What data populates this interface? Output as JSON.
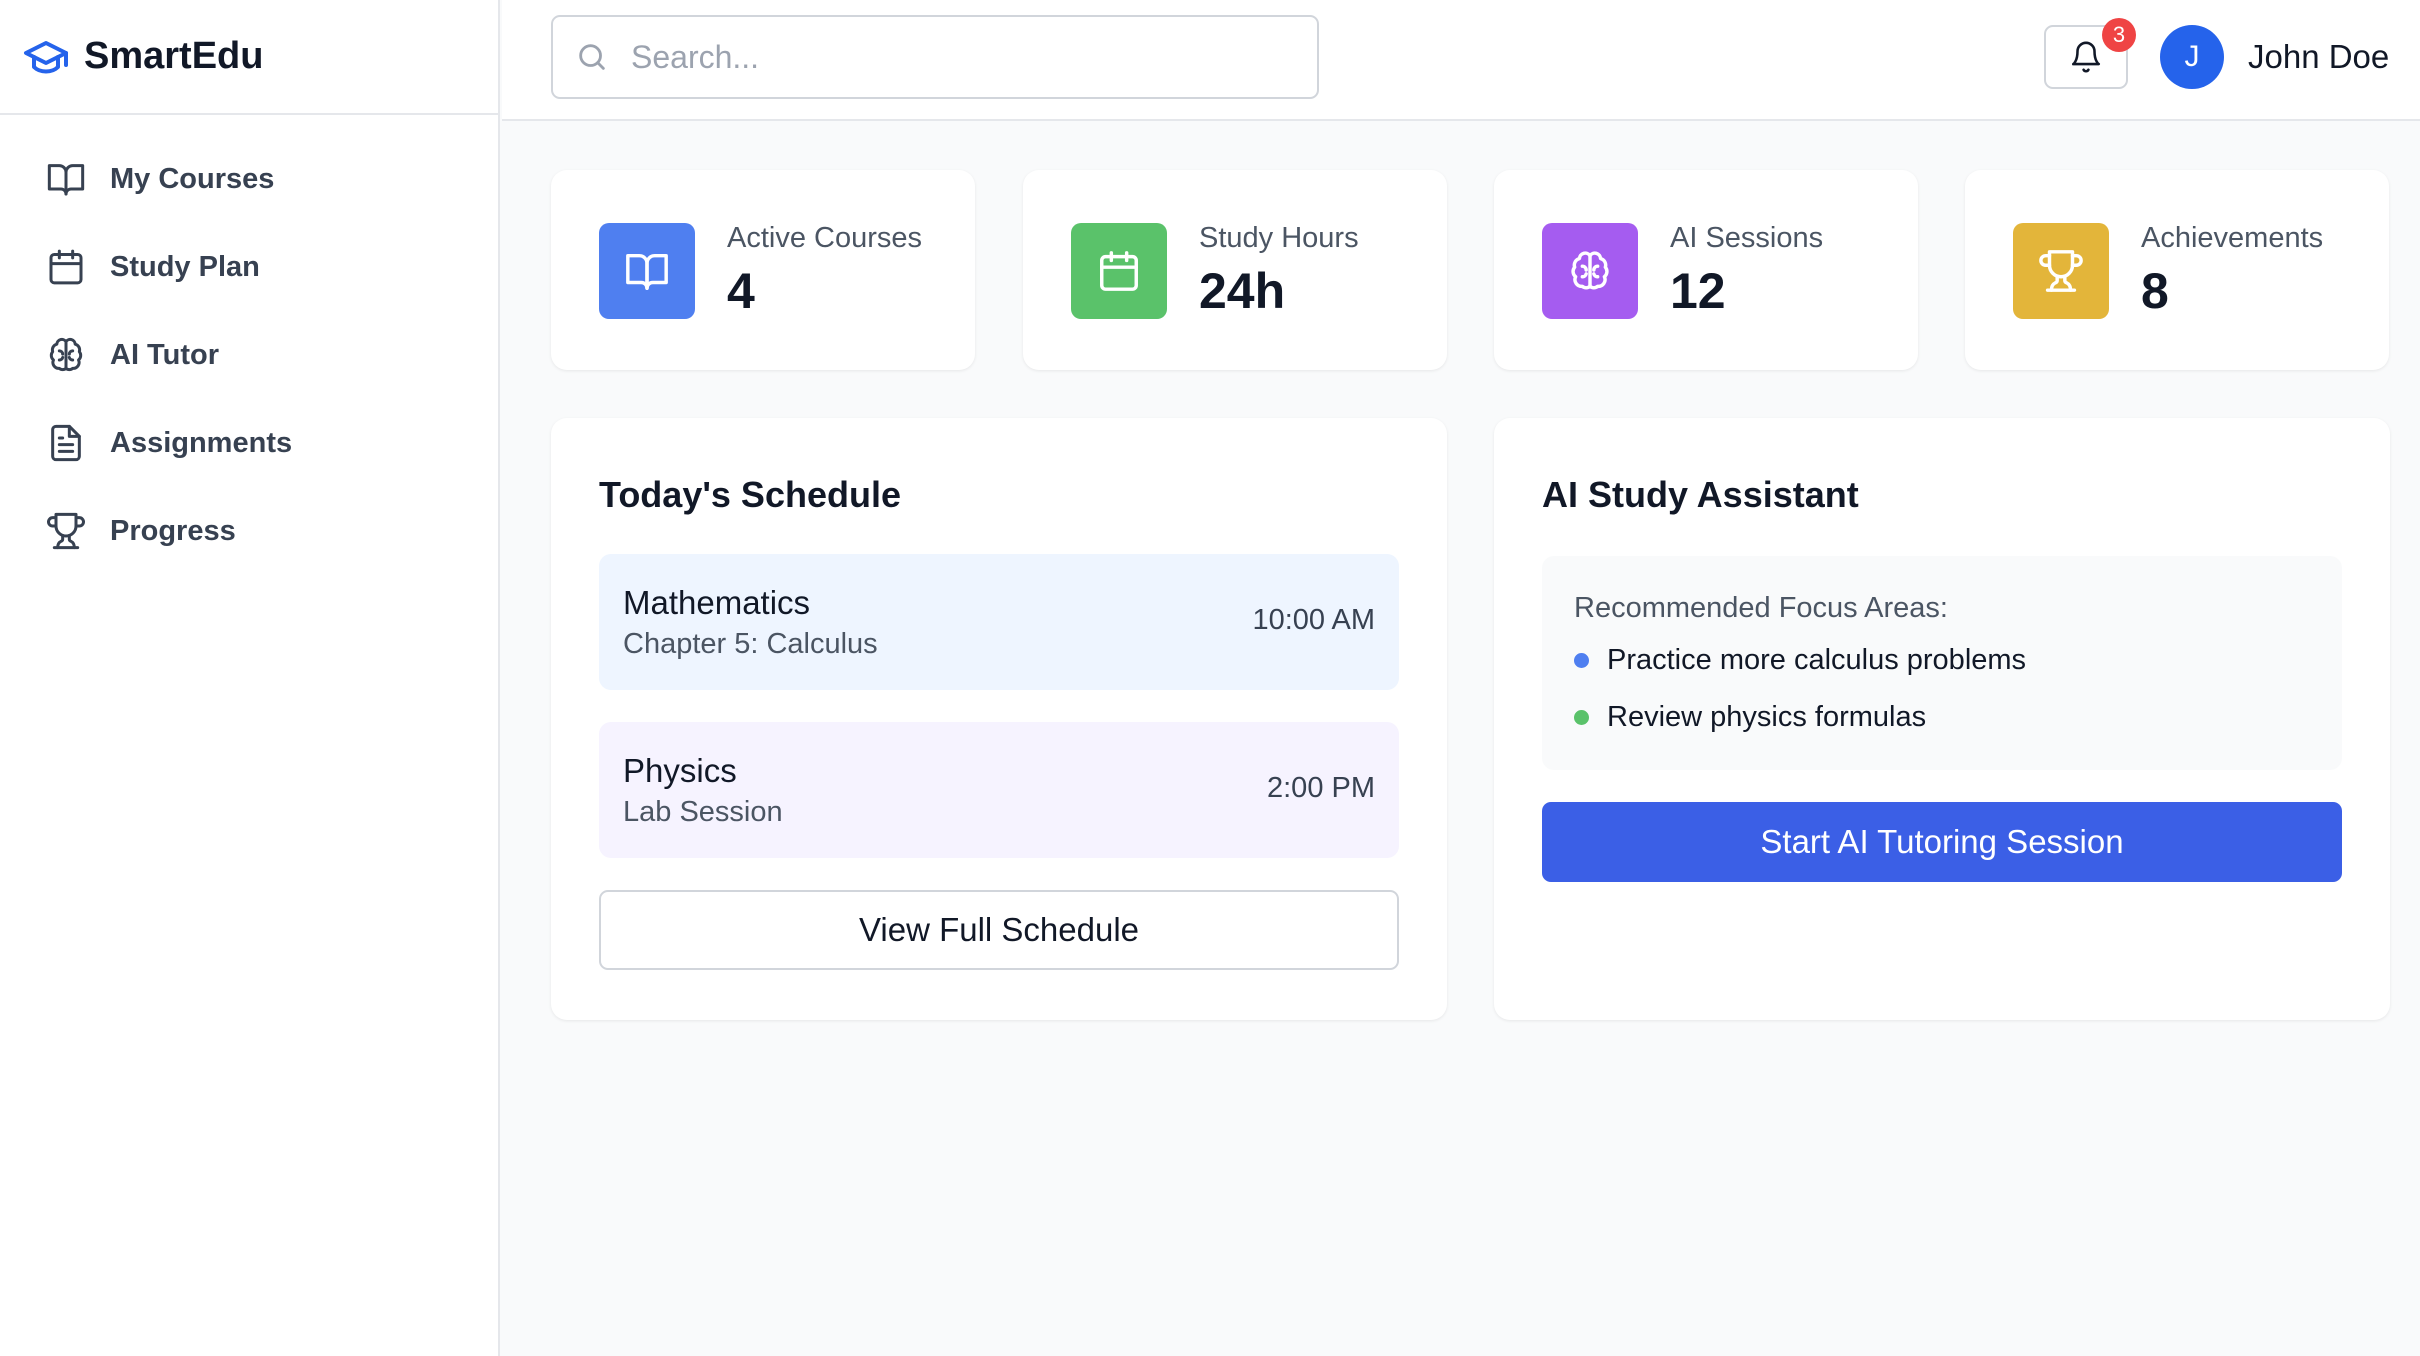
{
  "brand": {
    "name": "SmartEdu",
    "icon": "graduation-cap-icon"
  },
  "sidebar": {
    "items": [
      {
        "label": "My Courses",
        "icon": "book-open-icon"
      },
      {
        "label": "Study Plan",
        "icon": "calendar-icon"
      },
      {
        "label": "AI Tutor",
        "icon": "brain-icon"
      },
      {
        "label": "Assignments",
        "icon": "file-text-icon"
      },
      {
        "label": "Progress",
        "icon": "trophy-icon"
      }
    ]
  },
  "header": {
    "search_placeholder": "Search...",
    "notification_count": "3",
    "user_initial": "J",
    "user_name": "John Doe"
  },
  "stats": [
    {
      "label": "Active Courses",
      "value": "4",
      "icon": "book-open-icon",
      "color": "#4f7ff0"
    },
    {
      "label": "Study Hours",
      "value": "24h",
      "icon": "calendar-icon",
      "color": "#5ac26a"
    },
    {
      "label": "AI Sessions",
      "value": "12",
      "icon": "brain-icon",
      "color": "#a55cf0"
    },
    {
      "label": "Achievements",
      "value": "8",
      "icon": "trophy-icon",
      "color": "#e3b53a"
    }
  ],
  "schedule": {
    "title": "Today's Schedule",
    "items": [
      {
        "subject": "Mathematics",
        "detail": "Chapter 5: Calculus",
        "time": "10:00 AM",
        "bg": "#eef5ff"
      },
      {
        "subject": "Physics",
        "detail": "Lab Session",
        "time": "2:00 PM",
        "bg": "#f6f3ff"
      }
    ],
    "button_label": "View Full Schedule"
  },
  "assistant": {
    "title": "AI Study Assistant",
    "focus_heading": "Recommended Focus Areas:",
    "focus_items": [
      {
        "text": "Practice more calculus problems",
        "color": "#4f7ff0"
      },
      {
        "text": "Review physics formulas",
        "color": "#5ac26a"
      }
    ],
    "button_label": "Start AI Tutoring Session"
  },
  "colors": {
    "accent": "#3b5fe6",
    "avatar": "#2563eb",
    "badge": "#ef4444"
  }
}
